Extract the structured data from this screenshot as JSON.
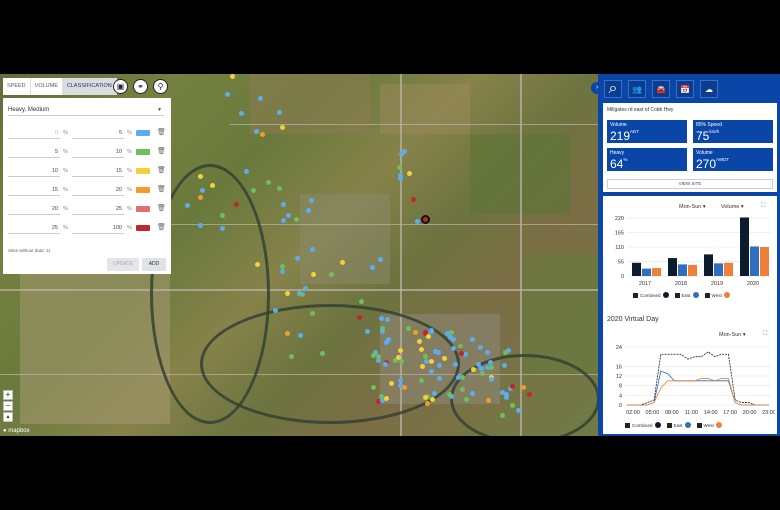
{
  "tabs": [
    {
      "label": "SPEED"
    },
    {
      "label": "VOLUME"
    },
    {
      "label": "CLASSIFICATION"
    }
  ],
  "classification_select": "Heavy, Medium",
  "ranges": [
    {
      "from": "0",
      "to": "5",
      "unit": "%",
      "color": "#5aaef0"
    },
    {
      "from": "5",
      "to": "10",
      "unit": "%",
      "color": "#6dc05a"
    },
    {
      "from": "10",
      "to": "15",
      "unit": "%",
      "color": "#f3d13a"
    },
    {
      "from": "15",
      "to": "20",
      "unit": "%",
      "color": "#f39c2a"
    },
    {
      "from": "20",
      "to": "25",
      "unit": "%",
      "color": "#e36d6d"
    },
    {
      "from": "25",
      "to": "100",
      "unit": "%",
      "color": "#c0272d"
    }
  ],
  "sites_note": "Sites without data: 11",
  "update_label": "UPDATE",
  "add_label": "ADD",
  "zoom_in": "+",
  "zoom_out": "−",
  "map_logo": "mapbox",
  "site_card": {
    "title": "Millgates rd east of Cobb Hwy",
    "kpis": [
      {
        "label": "Volume",
        "value": "219",
        "unit": "ADT"
      },
      {
        "label": "85% Speed",
        "value": "75",
        "unit": "km/h"
      },
      {
        "label": "Heavy",
        "value": "64",
        "unit": "%"
      },
      {
        "label": "Volume",
        "value": "270",
        "unit": "AWDT"
      }
    ],
    "view_site": "VIEW SITE"
  },
  "volume_card": {
    "period": "Mon-Sun",
    "metric": "Volume",
    "legend": [
      "Combined",
      "East",
      "West"
    ]
  },
  "virtual_day": {
    "title": "2020 Virtual Day",
    "period": "Mon-Sun",
    "legend": [
      "Combined",
      "East",
      "West"
    ]
  },
  "colors": {
    "combined": "#0d1b2e",
    "east": "#2f6fbf",
    "west": "#ef7f3a",
    "brand": "#0a46a8"
  },
  "chart_data": [
    {
      "type": "bar",
      "categories": [
        "2017",
        "2018",
        "2019",
        "2020"
      ],
      "series": [
        {
          "name": "Combined",
          "values": [
            50,
            68,
            82,
            222
          ]
        },
        {
          "name": "East",
          "values": [
            28,
            44,
            48,
            112
          ]
        },
        {
          "name": "West",
          "values": [
            30,
            42,
            50,
            110
          ]
        }
      ],
      "yticks": [
        "220",
        "165",
        "110",
        "55",
        "0"
      ],
      "ylim": [
        0,
        220
      ]
    },
    {
      "type": "line",
      "x": [
        "02:00",
        "05:00",
        "08:00",
        "11:00",
        "14:00",
        "17:00",
        "20:00",
        "23:00"
      ],
      "yticks": [
        "24",
        "16",
        "12",
        "8",
        "4",
        "0"
      ],
      "ylim": [
        0,
        24
      ],
      "series": [
        {
          "name": "Combined",
          "values": [
            0,
            0,
            0,
            1,
            2,
            21,
            21,
            21,
            21,
            19,
            20,
            20,
            22,
            20,
            21,
            21,
            2,
            1,
            1,
            0,
            0,
            0
          ]
        },
        {
          "name": "East",
          "values": [
            0,
            0,
            0,
            0,
            1,
            14,
            13,
            10,
            10,
            10,
            10,
            10,
            10,
            10,
            10,
            10,
            1,
            0,
            0,
            0,
            0,
            0
          ]
        },
        {
          "name": "West",
          "values": [
            0,
            0,
            0,
            0,
            1,
            7,
            10,
            10,
            10,
            10,
            10,
            11,
            11,
            10,
            11,
            11,
            1,
            0,
            0,
            0,
            0,
            0
          ]
        }
      ]
    }
  ]
}
